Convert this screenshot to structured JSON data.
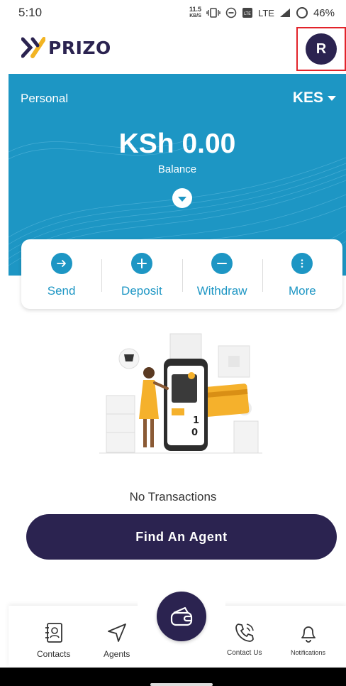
{
  "status_bar": {
    "time": "5:10",
    "speed_value": "11.5",
    "speed_unit": "KB/S",
    "network": "LTE",
    "battery": "46%"
  },
  "header": {
    "logo_text": "PRIZO",
    "avatar_initial": "R"
  },
  "balance": {
    "account_type": "Personal",
    "currency": "KES",
    "amount": "KSh 0.00",
    "label": "Balance"
  },
  "actions": [
    {
      "label": "Send",
      "icon": "arrow-right-icon"
    },
    {
      "label": "Deposit",
      "icon": "plus-icon"
    },
    {
      "label": "Withdraw",
      "icon": "minus-icon"
    },
    {
      "label": "More",
      "icon": "more-vertical-icon"
    }
  ],
  "transactions": {
    "empty_text": "No Transactions"
  },
  "find_agent_label": "Find An Agent",
  "bottom_nav": {
    "contacts": "Contacts",
    "agents": "Agents",
    "contact_us": "Contact Us",
    "notifications": "Notifications"
  },
  "colors": {
    "brand_dark": "#2b2350",
    "brand_blue": "#1d96c4",
    "highlight_border": "#e2232a"
  }
}
